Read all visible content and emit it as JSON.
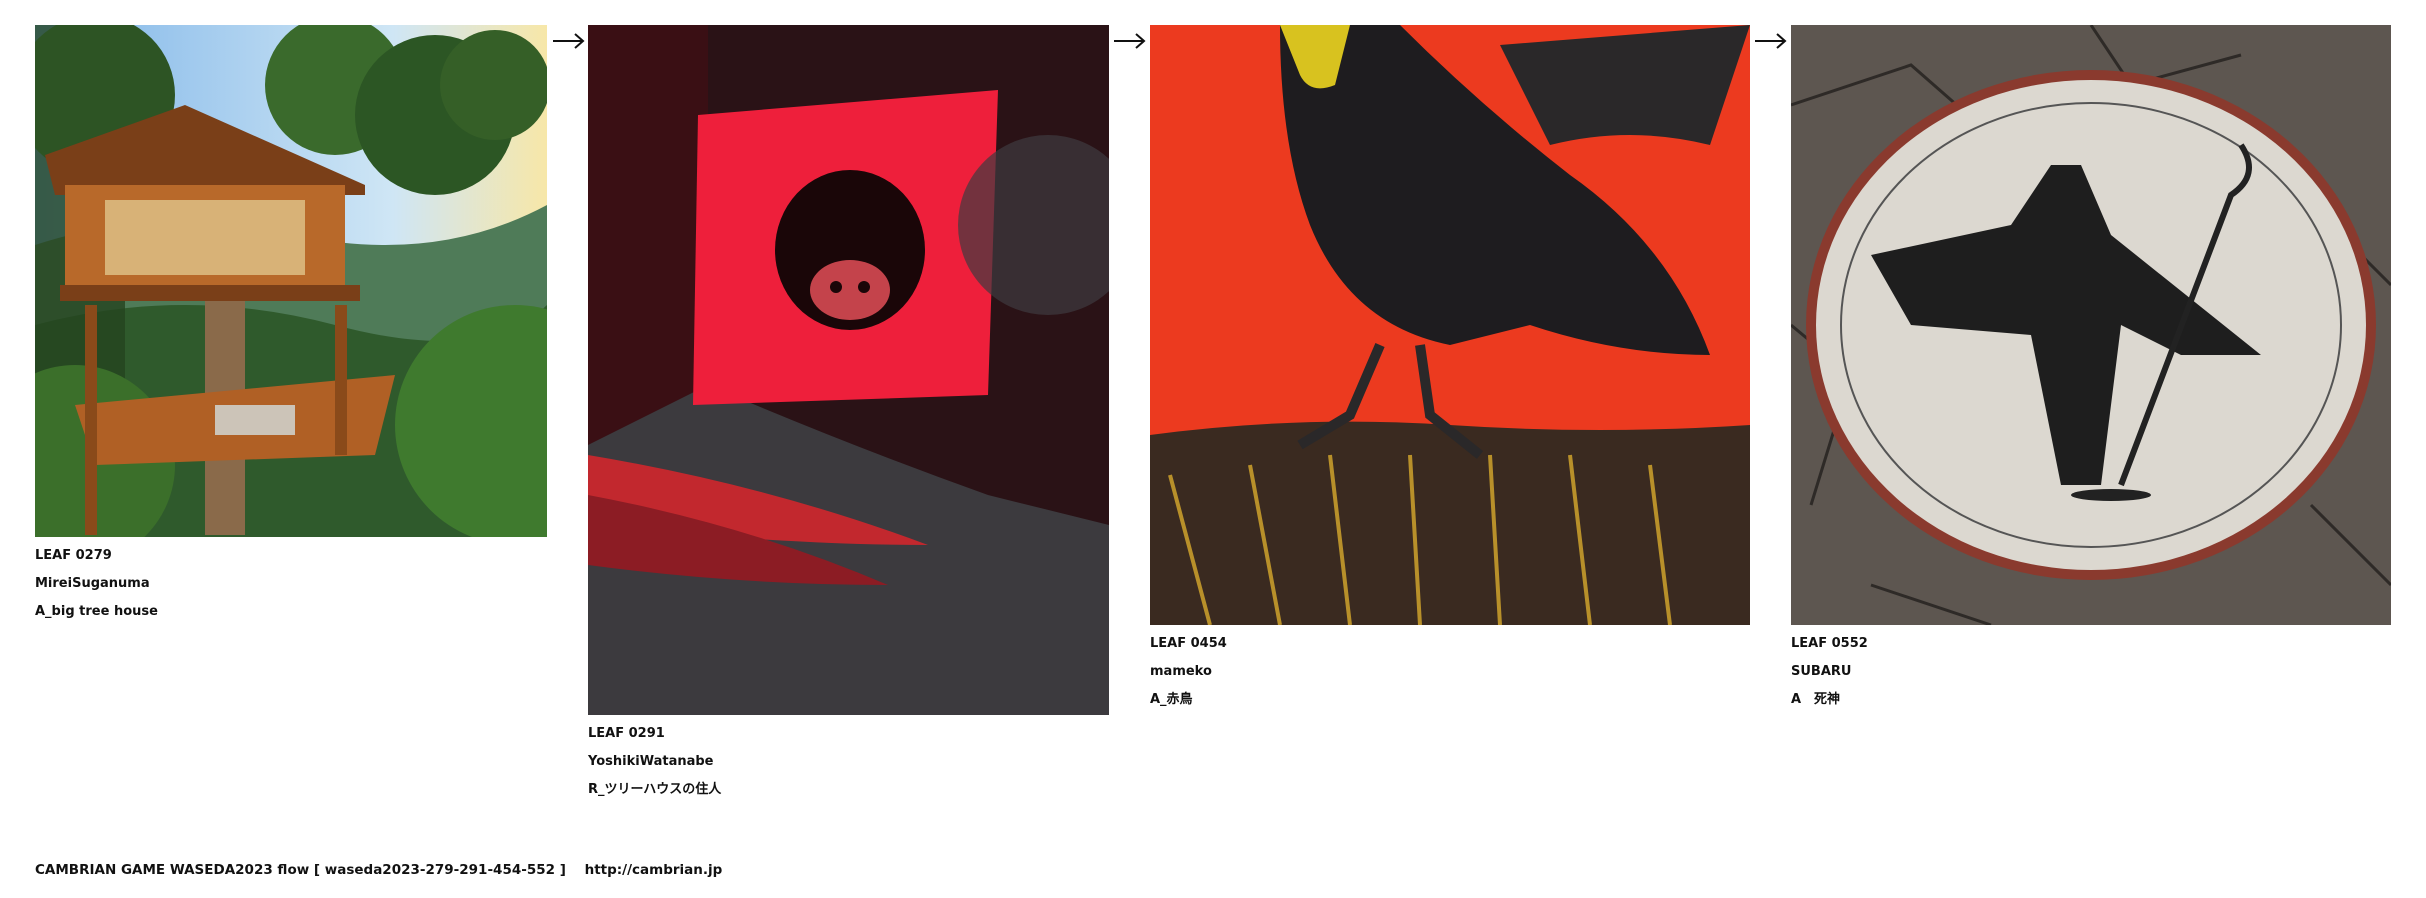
{
  "leaves": [
    {
      "id": "LEAF 0279",
      "author": "MireiSuganuma",
      "title": "A_big tree house",
      "image": "tree-house-photo"
    },
    {
      "id": "LEAF 0291",
      "author": "YoshikiWatanabe",
      "title": "R_ツリーハウスの住人",
      "image": "red-sign-animal-photo"
    },
    {
      "id": "LEAF 0454",
      "author": "mameko",
      "title": "A_赤鳥",
      "image": "crow-on-red-painting"
    },
    {
      "id": "LEAF 0552",
      "author": "SUBARU",
      "title": "A　死神",
      "image": "reaper-plate-image"
    }
  ],
  "footer": {
    "game": "CAMBRIAN GAME  WASEDA2023  flow [ waseda2023-279-291-454-552 ]",
    "url": "http://cambrian.jp"
  },
  "icons": [
    "arrow-right-icon"
  ]
}
